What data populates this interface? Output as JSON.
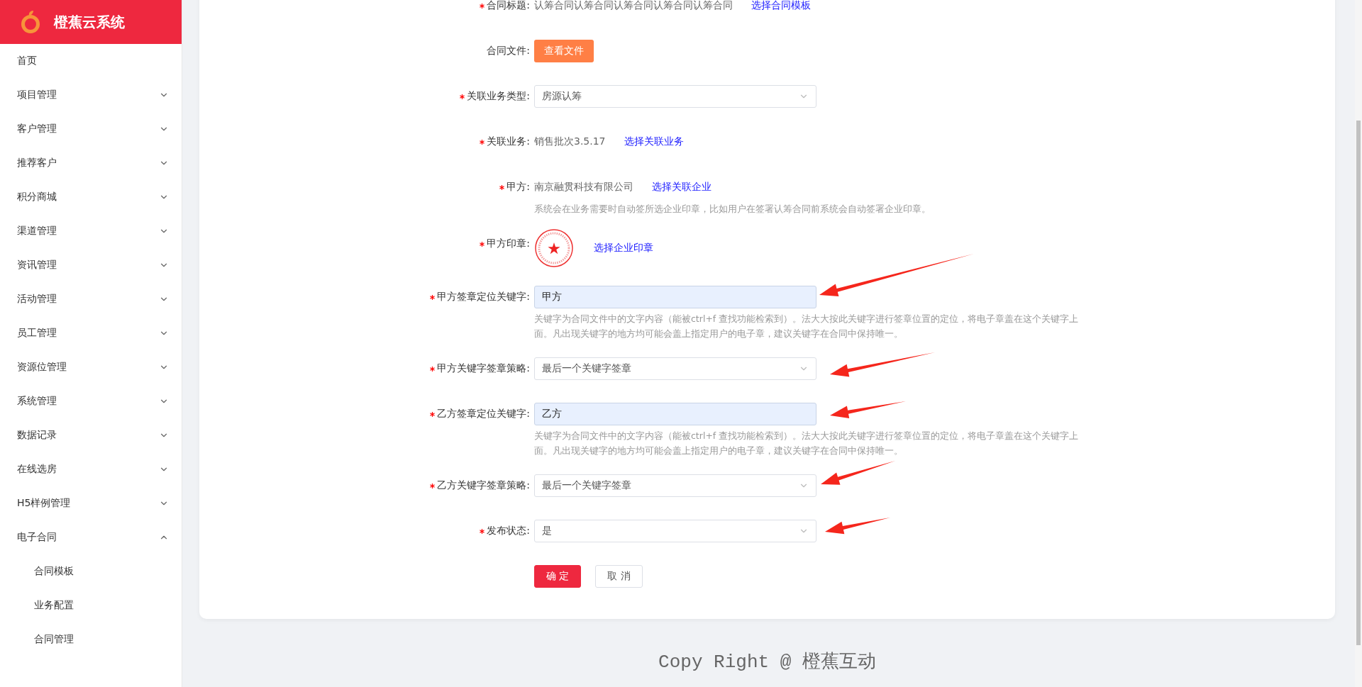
{
  "sidebar": {
    "logo_text": "橙蕉云系统",
    "items": [
      {
        "label": "首页",
        "kind": "link"
      },
      {
        "label": "项目管理",
        "kind": "group",
        "expanded": false
      },
      {
        "label": "客户管理",
        "kind": "group",
        "expanded": false
      },
      {
        "label": "推荐客户",
        "kind": "group",
        "expanded": false
      },
      {
        "label": "积分商城",
        "kind": "group",
        "expanded": false
      },
      {
        "label": "渠道管理",
        "kind": "group",
        "expanded": false
      },
      {
        "label": "资讯管理",
        "kind": "group",
        "expanded": false
      },
      {
        "label": "活动管理",
        "kind": "group",
        "expanded": false
      },
      {
        "label": "员工管理",
        "kind": "group",
        "expanded": false
      },
      {
        "label": "资源位管理",
        "kind": "group",
        "expanded": false
      },
      {
        "label": "系统管理",
        "kind": "group",
        "expanded": false
      },
      {
        "label": "数据记录",
        "kind": "group",
        "expanded": false
      },
      {
        "label": "在线选房",
        "kind": "group",
        "expanded": false
      },
      {
        "label": "H5样例管理",
        "kind": "group",
        "expanded": false
      },
      {
        "label": "电子合同",
        "kind": "group",
        "expanded": true,
        "children": [
          {
            "label": "合同模板"
          },
          {
            "label": "业务配置"
          },
          {
            "label": "合同管理"
          }
        ]
      }
    ]
  },
  "form": {
    "rows": [
      {
        "kind": "text",
        "label": "合同标题:",
        "required": true,
        "value": "认筹合同认筹合同认筹合同认筹合同认筹合同",
        "link": "选择合同模板"
      },
      {
        "kind": "button",
        "label": "合同文件:",
        "required": false,
        "button": "查看文件"
      },
      {
        "kind": "select",
        "label": "关联业务类型:",
        "required": true,
        "value": "房源认筹"
      },
      {
        "kind": "text",
        "label": "关联业务:",
        "required": true,
        "value": "销售批次3.5.17",
        "link": "选择关联业务"
      },
      {
        "kind": "text",
        "label": "甲方:",
        "required": true,
        "value": "南京融贯科技有限公司",
        "link": "选择关联企业",
        "hint": "系统会在业务需要时自动签所选企业印章，比如用户在签署认筹合同前系统会自动签署企业印章。"
      },
      {
        "kind": "seal",
        "label": "甲方印章:",
        "required": true,
        "link": "选择企业印章"
      },
      {
        "kind": "input",
        "label": "甲方签章定位关键字:",
        "required": true,
        "value": "甲方",
        "hint": "关键字为合同文件中的文字内容（能被ctrl+f 查找功能检索到）。法大大按此关键字进行签章位置的定位，将电子章盖在这个关键字上面。凡出现关键字的地方均可能会盖上指定用户的电子章，建议关键字在合同中保持唯一。"
      },
      {
        "kind": "select",
        "label": "甲方关键字签章策略:",
        "required": true,
        "value": "最后一个关键字签章"
      },
      {
        "kind": "input",
        "label": "乙方签章定位关键字:",
        "required": true,
        "value": "乙方",
        "hint": "关键字为合同文件中的文字内容（能被ctrl+f 查找功能检索到）。法大大按此关键字进行签章位置的定位，将电子章盖在这个关键字上面。凡出现关键字的地方均可能会盖上指定用户的电子章，建议关键字在合同中保持唯一。"
      },
      {
        "kind": "select",
        "label": "乙方关键字签章策略:",
        "required": true,
        "value": "最后一个关键字签章"
      },
      {
        "kind": "select",
        "label": "发布状态:",
        "required": true,
        "value": "是"
      }
    ],
    "actions": [
      {
        "label": "确 定",
        "kind": "primary"
      },
      {
        "label": "取 消",
        "kind": "default"
      }
    ]
  },
  "footer": "Copy Right @ 橙蕉互动"
}
